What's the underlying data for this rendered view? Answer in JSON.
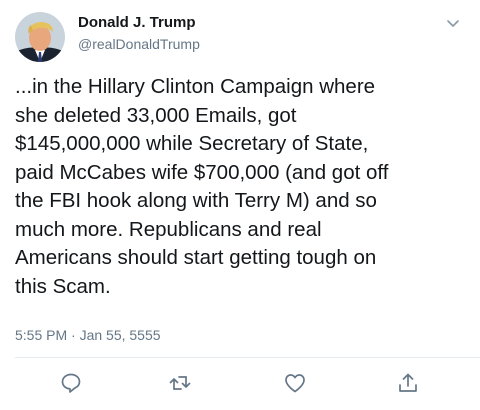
{
  "author": {
    "display_name": "Donald J. Trump",
    "handle": "@realDonaldTrump"
  },
  "tweet": {
    "lines": [
      "...in the Hillary Clinton Campaign where",
      "she deleted 33,000 Emails, got",
      "$145,000,000 while Secretary of State,",
      "paid McCabes wife $700,000 (and got off",
      "the FBI hook along with Terry M) and so",
      "much more. Republicans and real",
      "Americans should start getting tough on",
      "this Scam."
    ],
    "timestamp": "5:55 PM · Jan 55, 5555"
  },
  "icons": {
    "menu": "chevron-down-icon",
    "reply": "reply-icon",
    "retweet": "retweet-icon",
    "like": "heart-icon",
    "share": "share-icon"
  },
  "colors": {
    "text": "#14171a",
    "secondary": "#657786",
    "divider": "#e6ecf0"
  }
}
